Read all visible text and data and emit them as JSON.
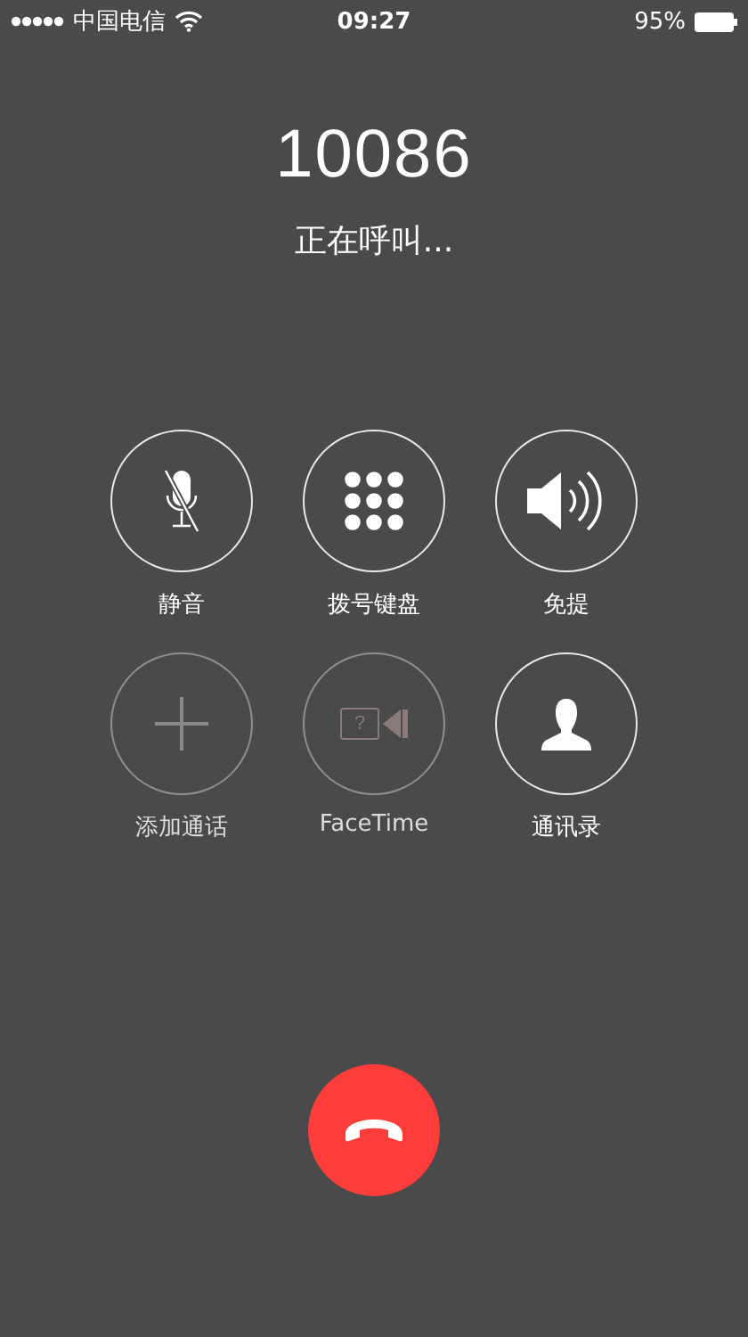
{
  "status_bar": {
    "carrier": "中国电信",
    "time": "09:27",
    "battery": "95%"
  },
  "call": {
    "number": "10086",
    "status": "正在呼叫..."
  },
  "buttons": [
    {
      "kind": "mute",
      "label": "静音",
      "disabled": false
    },
    {
      "kind": "keypad",
      "label": "拨号键盘",
      "disabled": false
    },
    {
      "kind": "speaker",
      "label": "免提",
      "disabled": false
    },
    {
      "kind": "add",
      "label": "添加通话",
      "disabled": true
    },
    {
      "kind": "facetime",
      "label": "FaceTime",
      "disabled": true,
      "icon_glyph": "?"
    },
    {
      "kind": "contacts",
      "label": "通讯录",
      "disabled": false
    }
  ]
}
